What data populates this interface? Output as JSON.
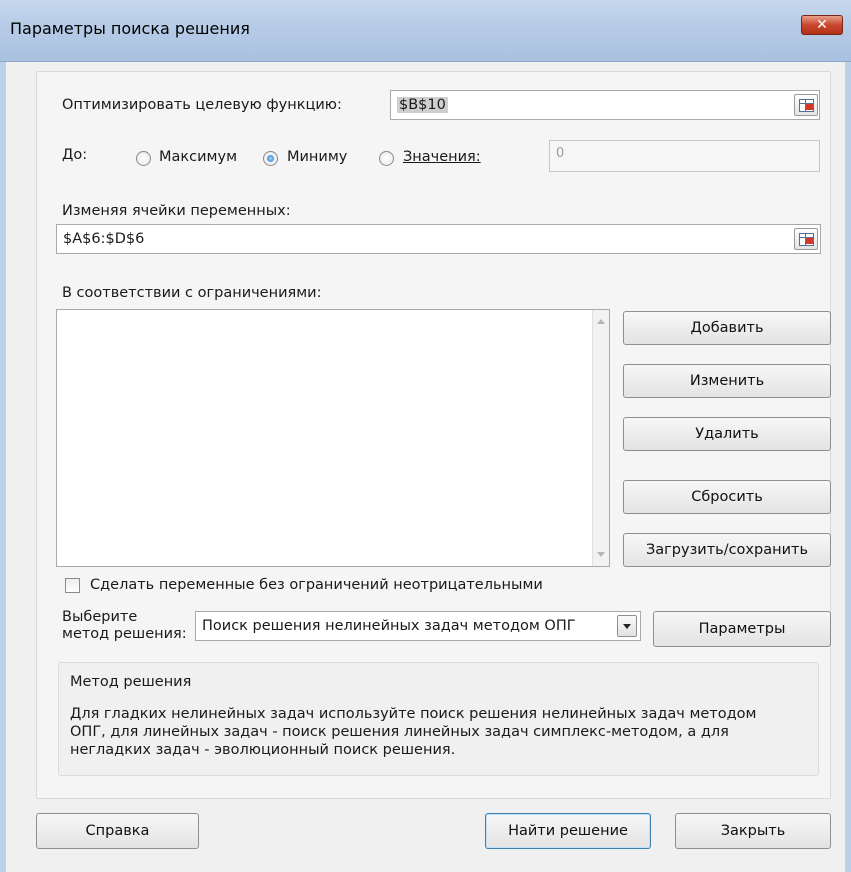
{
  "window": {
    "title": "Параметры поиска решения",
    "close_glyph": "✕"
  },
  "objective": {
    "label": "Оптимизировать целевую функцию:",
    "value": "$B$10"
  },
  "to": {
    "label": "До:",
    "options": [
      {
        "label": "Максимум",
        "selected": false
      },
      {
        "label": "Миниму",
        "selected": true
      },
      {
        "label": "Значения:",
        "selected": false
      }
    ],
    "value_field": "0"
  },
  "variables": {
    "label": "Изменяя ячейки переменных:",
    "value": "$A$6:$D$6"
  },
  "constraints": {
    "label": "В соответствии с ограничениями:",
    "items": []
  },
  "constraint_buttons": {
    "add": "Добавить",
    "change": "Изменить",
    "delete": "Удалить",
    "reset": "Сбросить",
    "load_save": "Загрузить/сохранить"
  },
  "nonnegative": {
    "label": "Сделать переменные без ограничений неотрицательными",
    "checked": false
  },
  "method": {
    "label_line1": "Выберите",
    "label_line2": "метод решения:",
    "selected": "Поиск решения нелинейных задач методом ОПГ",
    "params_button": "Параметры"
  },
  "method_info": {
    "heading": "Метод решения",
    "line1": "Для гладких нелинейных задач используйте поиск решения нелинейных задач методом",
    "line2": "ОПГ, для линейных задач - поиск решения линейных задач симплекс-методом, а для",
    "line3": "негладких задач - эволюционный поиск решения."
  },
  "footer": {
    "help": "Справка",
    "solve": "Найти решение",
    "close": "Закрыть"
  }
}
